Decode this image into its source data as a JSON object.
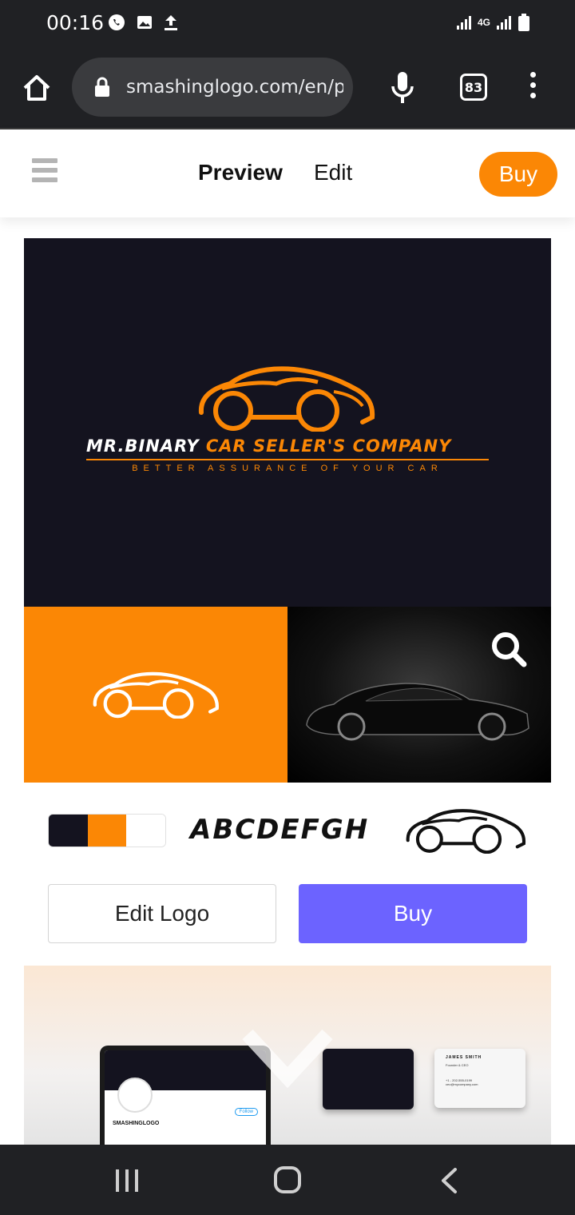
{
  "status_bar": {
    "time": "00:16",
    "left_icons": [
      "whatsapp-icon",
      "image-icon",
      "upload-icon"
    ],
    "right_icons": [
      "signal-icon",
      "4g-icon",
      "signal-icon",
      "battery-icon"
    ],
    "network_label": "4G"
  },
  "browser": {
    "url": "smashinglogo.com/en/p",
    "tab_count": "83",
    "icons": [
      "home-icon",
      "lock-icon",
      "mic-icon",
      "tabs-icon",
      "more-icon"
    ]
  },
  "site_nav": {
    "menu_icon": "hamburger-icon",
    "preview_label": "Preview",
    "edit_label": "Edit",
    "buy_label": "Buy"
  },
  "logo": {
    "brand_part_1": "MR.BINARY",
    "brand_part_2": "CAR SELLER'S COMPANY",
    "tagline": "BETTER ASSURANCE OF YOUR CAR",
    "icon": "sports-car-icon"
  },
  "assets": {
    "palette": [
      "#14131f",
      "#fb8705",
      "#ffffff"
    ],
    "font_sample": "ABCDEFGH"
  },
  "actions": {
    "edit_logo_label": "Edit Logo",
    "buy_label": "Buy"
  },
  "mockup": {
    "tablet_handle": "SMASHINGLOGO",
    "tablet_follow": "Follow",
    "card_name": "JAMES SMITH",
    "card_role": "Founder & CEO",
    "card_phone": "+1 - 202-555-0199",
    "card_email": "ceo@mycompany.com"
  },
  "colors": {
    "accent_orange": "#fb8705",
    "buy_purple": "#6c63ff",
    "logo_background": "#14131f",
    "browser_chrome": "#202124"
  }
}
